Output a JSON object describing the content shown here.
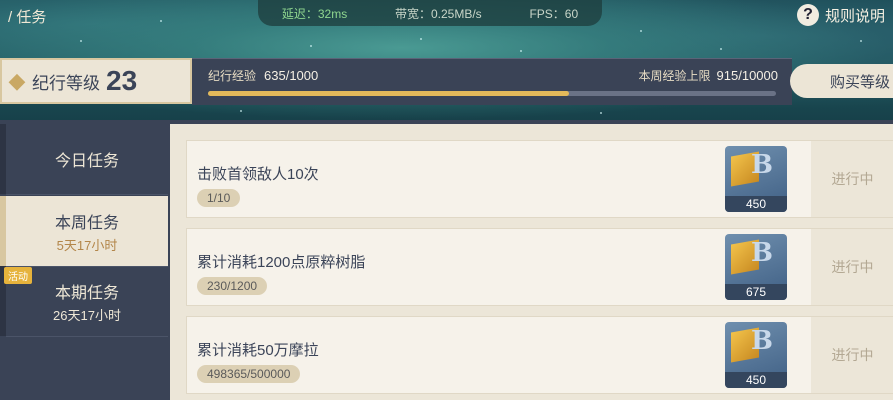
{
  "header": {
    "breadcrumb": "/ 任务",
    "latency": "延迟：32ms",
    "bandwidth": "带宽：0.25MB/s",
    "fps": "FPS：60",
    "help_label": "规则说明",
    "help_icon": "?"
  },
  "level": {
    "label": "纪行等级",
    "value": "23",
    "exp_label": "纪行经验",
    "exp_value": "635/1000",
    "exp_progress": 0.635,
    "week_label": "本周经验上限",
    "week_value": "915/10000",
    "buy_label": "购买等级"
  },
  "tabs": [
    {
      "label": "今日任务",
      "sub": ""
    },
    {
      "label": "本周任务",
      "sub": "5天17小时"
    },
    {
      "label": "本期任务",
      "sub": "26天17小时"
    }
  ],
  "event_badge": "活动",
  "tasks": [
    {
      "title": "击败首领敌人10次",
      "progress": "1/10",
      "reward": "450",
      "status": "进行中"
    },
    {
      "title": "累计消耗1200点原粹树脂",
      "progress": "230/1200",
      "reward": "675",
      "status": "进行中"
    },
    {
      "title": "累计消耗50万摩拉",
      "progress": "498365/500000",
      "reward": "450",
      "status": "进行中"
    }
  ],
  "reward_icon_letter": "B",
  "colors": {
    "accent": "#e3b95a",
    "panel": "#3a4356",
    "cream": "#ece5d6"
  }
}
